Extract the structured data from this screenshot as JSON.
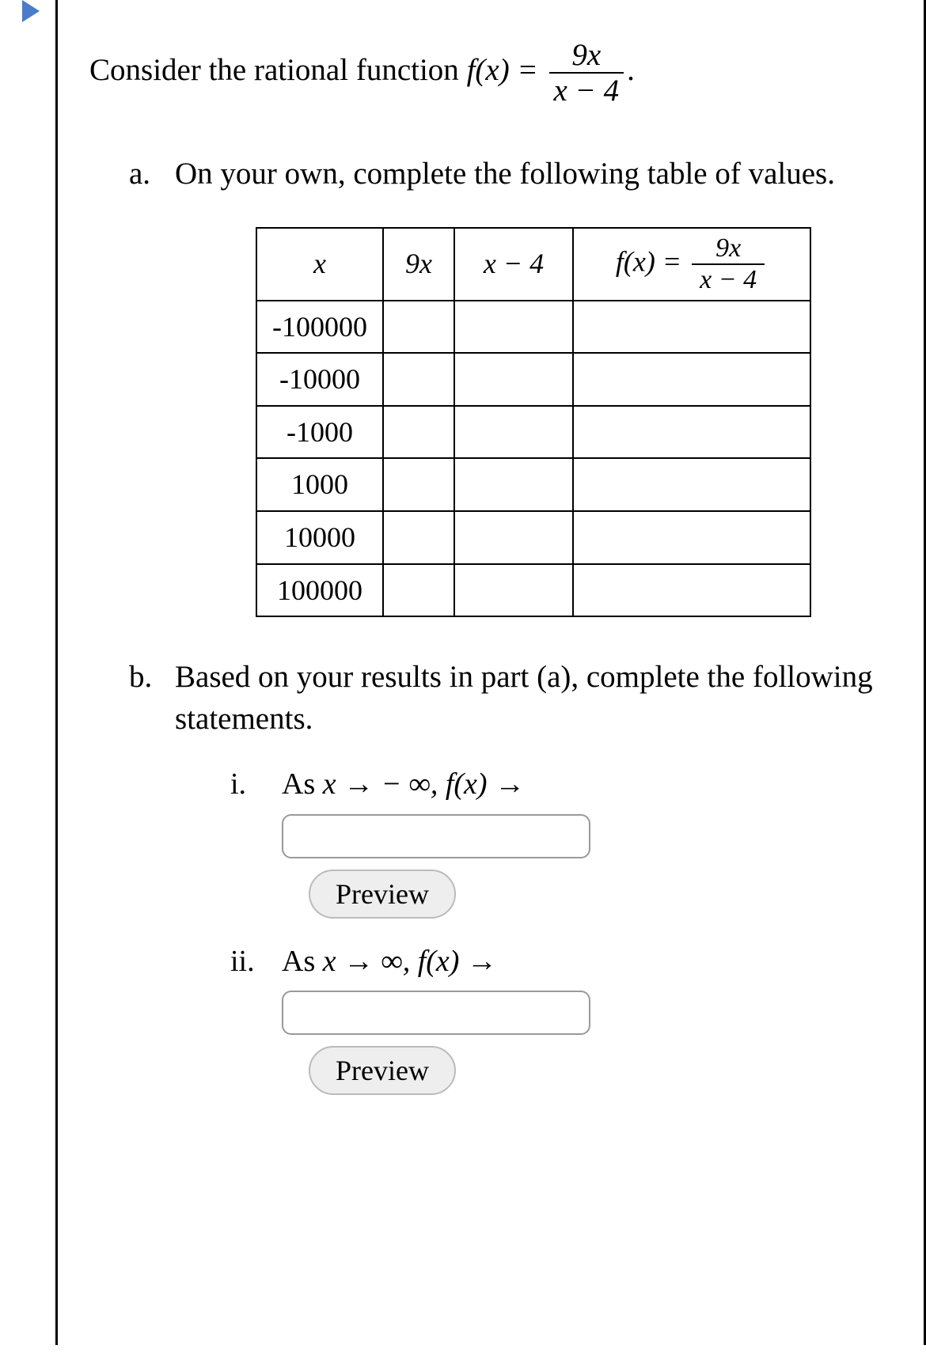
{
  "intro_prefix": "Consider the rational function ",
  "fn_lhs": "f(x) = ",
  "fn_num": "9x",
  "fn_den": "x − 4",
  "intro_suffix": ".",
  "parts": {
    "a": {
      "marker": "a.",
      "text": "On your own, complete the following table of values.",
      "table": {
        "headers": {
          "x": "x",
          "c9x": "9x",
          "cxm4": "x − 4",
          "cfx_lhs": "f(x) = ",
          "cfx_num": "9x",
          "cfx_den": "x − 4"
        },
        "rows": [
          {
            "x": "-100000",
            "c9x": "",
            "cxm4": "",
            "cfx": ""
          },
          {
            "x": "-10000",
            "c9x": "",
            "cxm4": "",
            "cfx": ""
          },
          {
            "x": "-1000",
            "c9x": "",
            "cxm4": "",
            "cfx": ""
          },
          {
            "x": "1000",
            "c9x": "",
            "cxm4": "",
            "cfx": ""
          },
          {
            "x": "10000",
            "c9x": "",
            "cxm4": "",
            "cfx": ""
          },
          {
            "x": "100000",
            "c9x": "",
            "cxm4": "",
            "cfx": ""
          }
        ]
      }
    },
    "b": {
      "marker": "b.",
      "text": "Based on your results in part (a), complete the following statements.",
      "items": {
        "i": {
          "marker": "i.",
          "statement_prefix": "As ",
          "statement_mid": "x →  − ∞, f(x) →",
          "preview": "Preview"
        },
        "ii": {
          "marker": "ii.",
          "statement_prefix": "As ",
          "statement_mid": "x → ∞, f(x) →",
          "preview": "Preview"
        }
      }
    }
  }
}
